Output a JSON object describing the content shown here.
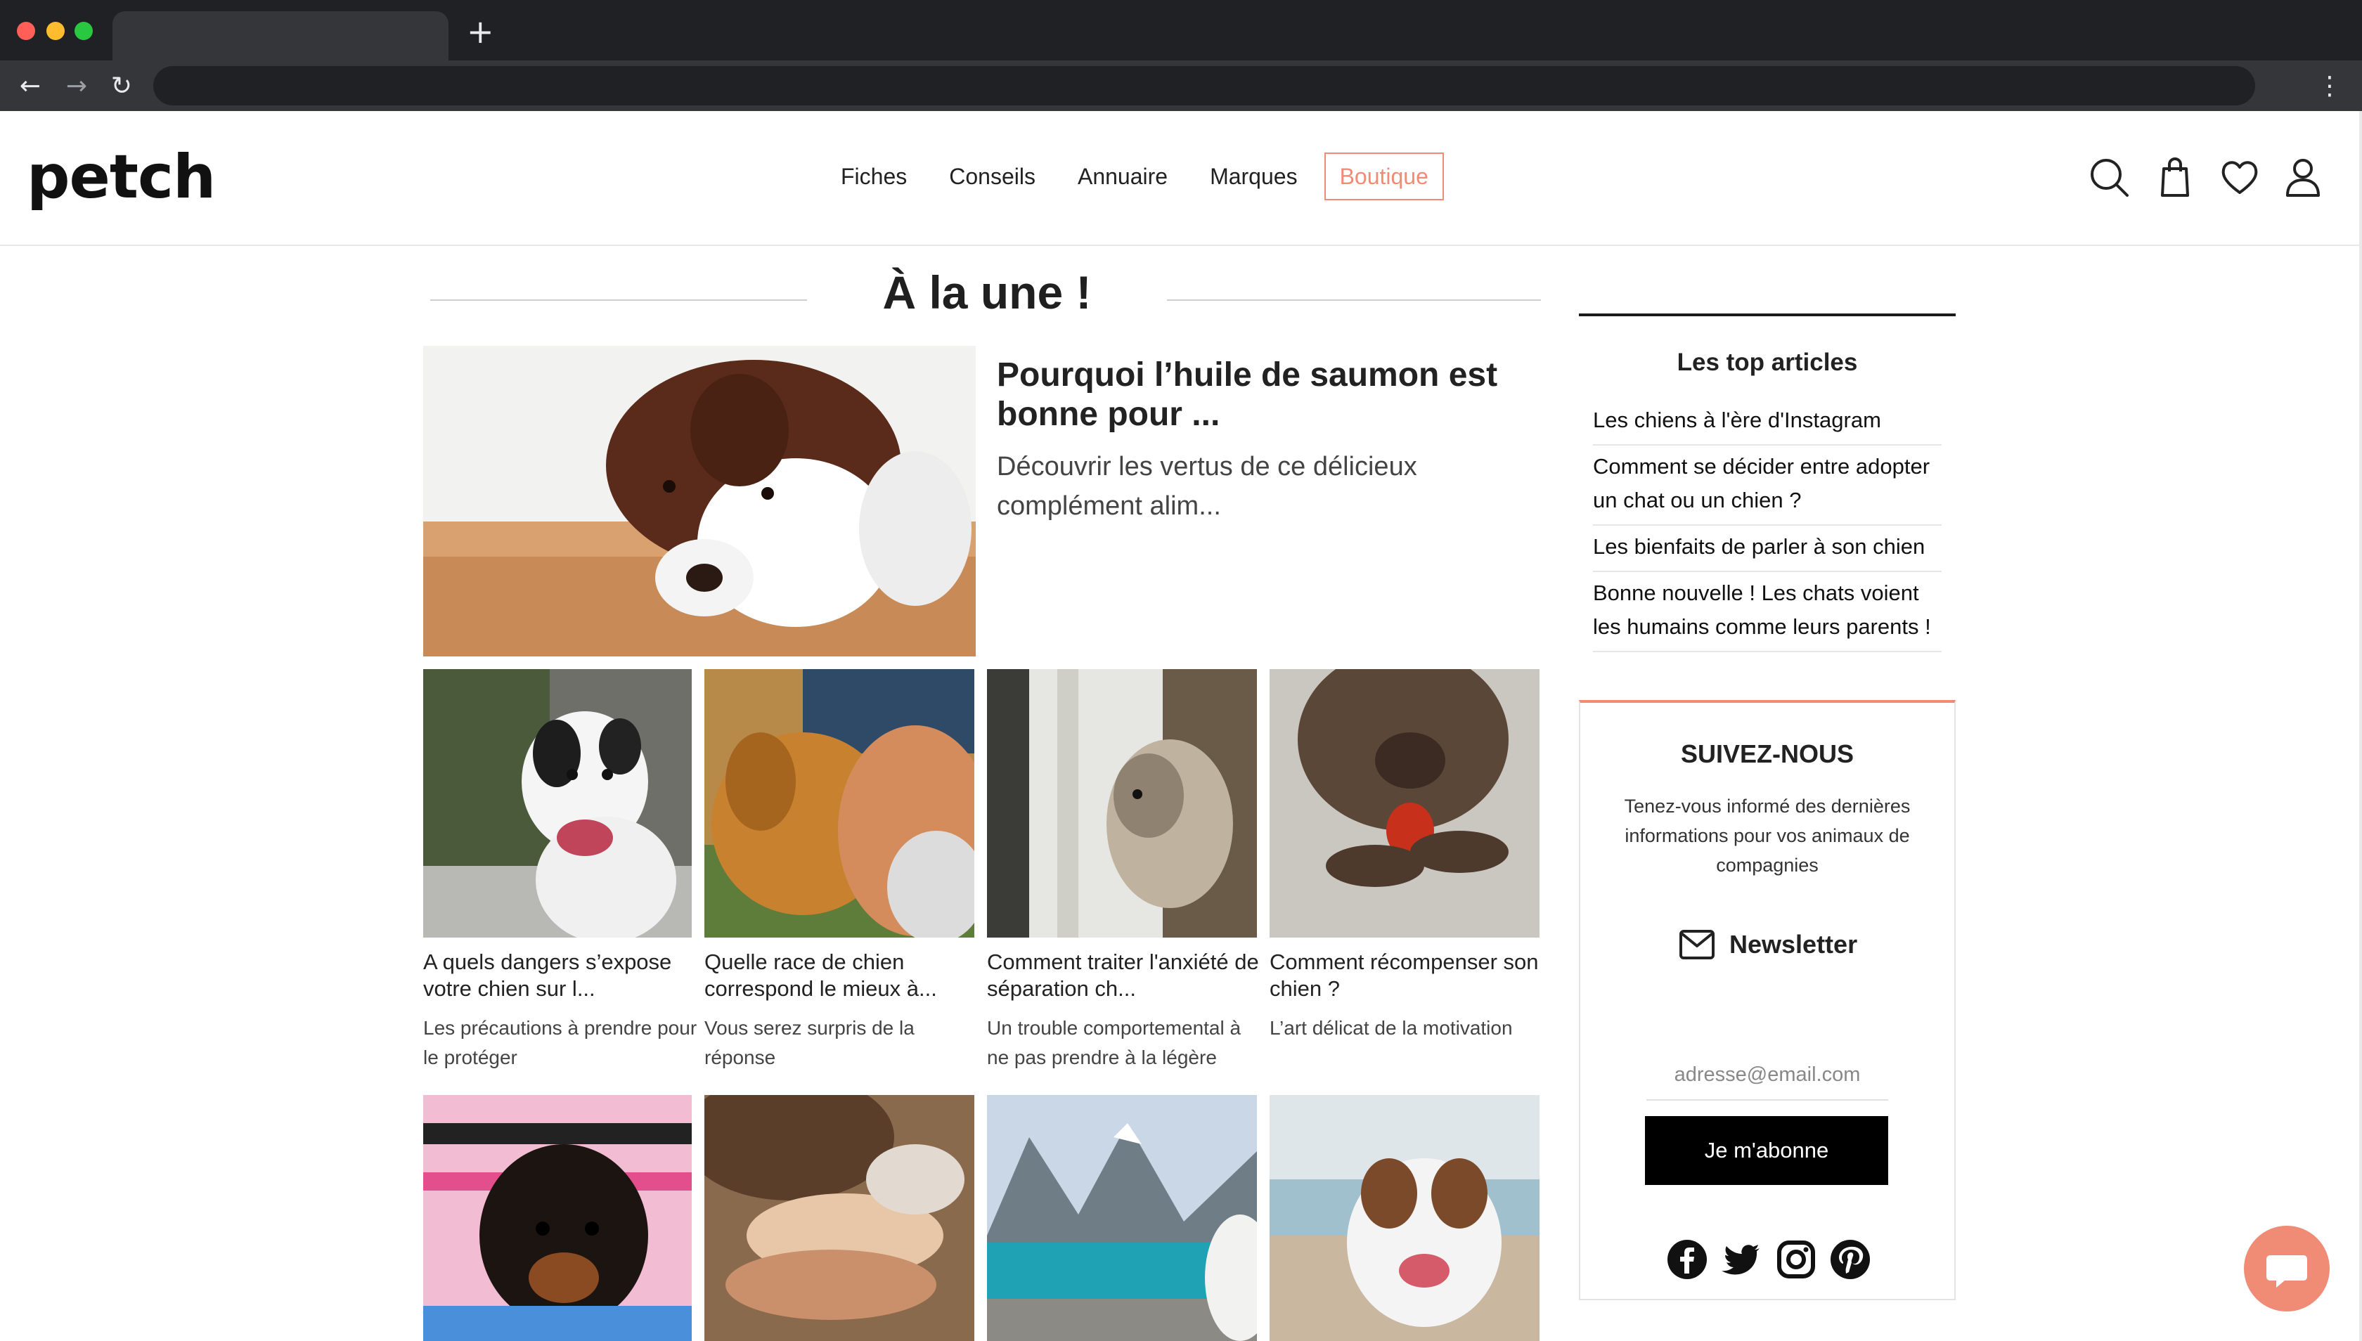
{
  "browser": {
    "new_tab_icon": "plus-icon",
    "back_icon": "arrow-left-icon",
    "forward_icon": "arrow-right-icon",
    "reload_icon": "reload-icon",
    "menu_icon": "kebab-menu-icon",
    "traffic_lights": [
      "#ff5f57",
      "#febc2e",
      "#28c840"
    ]
  },
  "header": {
    "logo": "petch",
    "nav": [
      "Fiches",
      "Conseils",
      "Annuaire",
      "Marques"
    ],
    "shop_label": "Boutique",
    "icons": [
      "search-icon",
      "shopping-bag-icon",
      "heart-icon",
      "user-icon"
    ],
    "accent_color": "#f08b76"
  },
  "main": {
    "section_title": "À la une !",
    "featured": {
      "title": "Pourquoi l’huile de saumon est bonne pour ...",
      "description": "Découvrir les vertus de ce délicieux complément alim..."
    },
    "cards": [
      {
        "title": "A quels dangers s’expose votre chien sur l...",
        "subtitle": "Les précautions à prendre pour le protéger"
      },
      {
        "title": "Quelle race de chien correspond le mieux à...",
        "subtitle": "Vous serez surpris de la réponse"
      },
      {
        "title": "Comment traiter l'anxiété de séparation ch...",
        "subtitle": "Un trouble comportemental à ne pas prendre à la légère"
      },
      {
        "title": "Comment récompenser son chien ?",
        "subtitle": "L’art délicat de la motivation"
      }
    ]
  },
  "sidebar": {
    "top_heading": "Les top articles",
    "top_articles": [
      "Les chiens à l'ère d'Instagram",
      "Comment se décider entre adopter un chat ou un chien ?",
      "Les bienfaits de parler à son chien",
      "Bonne nouvelle ! Les chats voient les humains comme leurs parents !"
    ],
    "follow": {
      "title": "SUIVEZ-NOUS",
      "text": "Tenez-vous informé des dernières informations pour vos animaux de compagnies",
      "newsletter_label": "Newsletter",
      "email_placeholder": "adresse@email.com",
      "subscribe_label": "Je m'abonne",
      "social_icons": [
        "facebook-icon",
        "twitter-icon",
        "instagram-icon",
        "pinterest-icon"
      ]
    }
  },
  "chat": {
    "icon": "chat-bubble-icon"
  }
}
